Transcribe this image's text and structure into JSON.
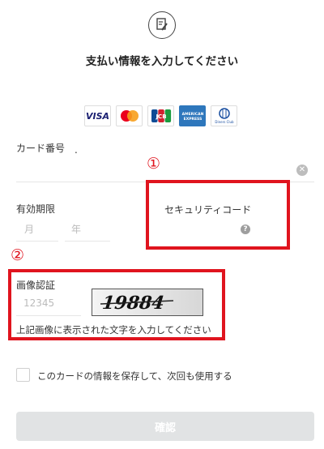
{
  "header": {
    "title": "支払い情報を入力してください"
  },
  "icons": {
    "header": "edit-document-icon"
  },
  "cards": {
    "visa": "VISA",
    "mastercard": "mastercard",
    "jcb": "JCB",
    "amex": "AMERICAN EXPRESS",
    "diners": "Diners Club"
  },
  "form": {
    "card_number_label": "カード番号",
    "card_number_mark": ".",
    "expiry_label": "有効期限",
    "month_placeholder": "月",
    "year_placeholder": "年",
    "security_code_label": "セキュリティコード",
    "captcha_label": "画像認証",
    "captcha_placeholder": "12345",
    "captcha_image_text": "19884",
    "captcha_hint": "上記画像に表示された文字を入力してください",
    "save_card_label": "このカードの情報を保存して、次回も使用する",
    "submit_label": "確認"
  },
  "annotations": {
    "marker_1": "①",
    "marker_2": "②"
  },
  "colors": {
    "annotation_red": "#e0141e",
    "button_disabled": "#e1e3e4"
  }
}
